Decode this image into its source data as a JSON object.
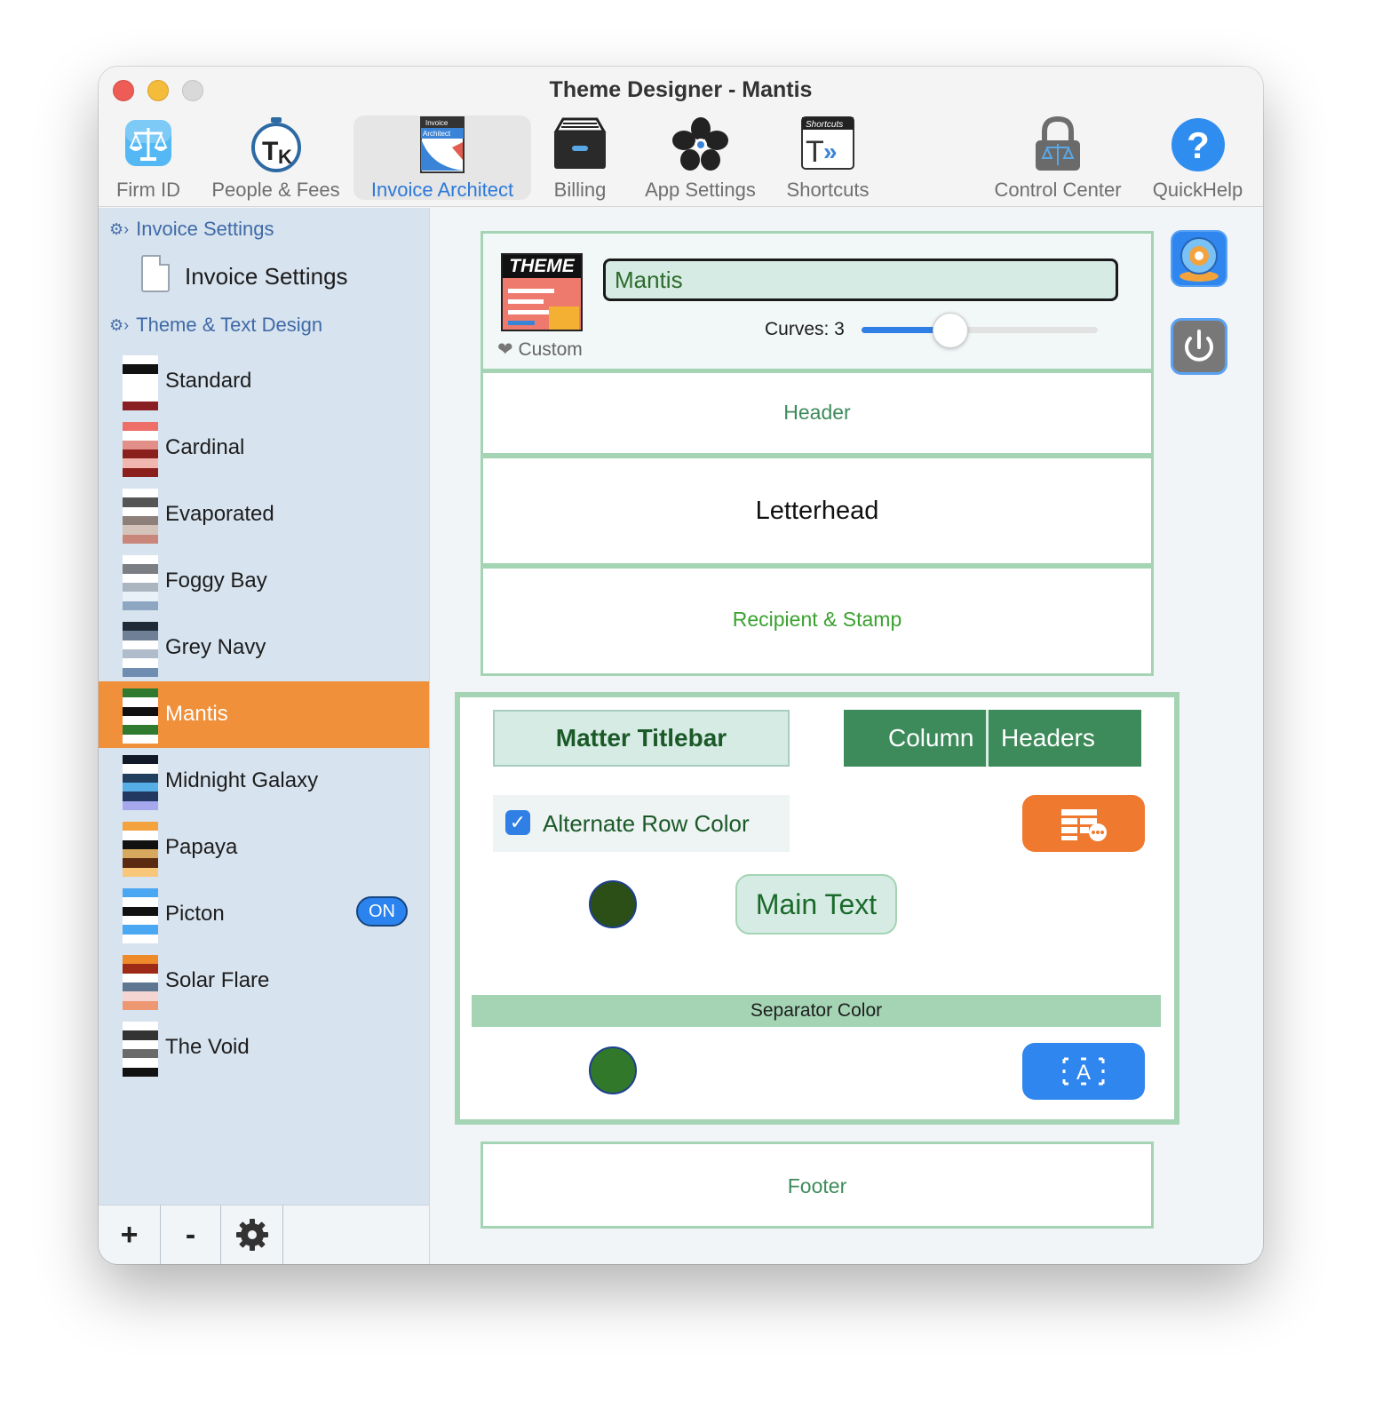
{
  "window": {
    "title": "Theme Designer - Mantis"
  },
  "toolbar": {
    "items": [
      {
        "label": "Firm ID",
        "icon": "scales-icon"
      },
      {
        "label": "People & Fees",
        "icon": "timekeeper-icon"
      },
      {
        "label": "Invoice Architect",
        "icon": "invoice-architect-icon",
        "active": true
      },
      {
        "label": "Billing",
        "icon": "file-box-icon"
      },
      {
        "label": "App Settings",
        "icon": "flower-icon"
      },
      {
        "label": "Shortcuts",
        "icon": "shortcuts-icon"
      },
      {
        "label": "Control Center",
        "icon": "lock-scales-icon"
      },
      {
        "label": "QuickHelp",
        "icon": "question-icon"
      }
    ],
    "invoice_icon_text_1": "Invoice",
    "invoice_icon_text_2": "Architect",
    "shortcuts_icon_text": "Shortcuts"
  },
  "sidebar": {
    "section_invoice": "Invoice Settings",
    "invoice_item": "Invoice Settings",
    "section_theme": "Theme & Text Design",
    "themes": [
      {
        "name": "Standard",
        "stripes": [
          "#ffffff",
          "#111111",
          "#ffffff",
          "#ffffff",
          "#ffffff",
          "#8a1f23"
        ]
      },
      {
        "name": "Cardinal",
        "stripes": [
          "#ee6f6a",
          "#ffffff",
          "#e28f8a",
          "#8a1f1b",
          "#f2b6b0",
          "#8a1f1b"
        ]
      },
      {
        "name": "Evaporated",
        "stripes": [
          "#ffffff",
          "#555555",
          "#ffffff",
          "#8d7f79",
          "#d4c3ba",
          "#c9877c"
        ]
      },
      {
        "name": "Foggy Bay",
        "stripes": [
          "#ffffff",
          "#7b7f84",
          "#ffffff",
          "#aab5c0",
          "#e8f0f8",
          "#8da7c2"
        ]
      },
      {
        "name": "Grey Navy",
        "stripes": [
          "#1f2937",
          "#6f7f95",
          "#ffffff",
          "#b0bccb",
          "#ffffff",
          "#6e8db0"
        ]
      },
      {
        "name": "Mantis",
        "stripes": [
          "#2f7a2f",
          "#ffffff",
          "#111111",
          "#ffffff",
          "#2f7a2f",
          "#ffffff"
        ],
        "selected": true
      },
      {
        "name": "Midnight Galaxy",
        "stripes": [
          "#111827",
          "#ffffff",
          "#233f5f",
          "#55aee6",
          "#223860",
          "#a6a8ee"
        ]
      },
      {
        "name": "Papaya",
        "stripes": [
          "#f3a23e",
          "#ffffff",
          "#111111",
          "#d7a95f",
          "#5a2a12",
          "#f8c77a"
        ]
      },
      {
        "name": "Picton",
        "stripes": [
          "#4aa7f2",
          "#ffffff",
          "#111111",
          "#ffffff",
          "#4aa7f2",
          "#ffffff"
        ],
        "badge": "ON"
      },
      {
        "name": "Solar Flare",
        "stripes": [
          "#ef8a2b",
          "#9d2a17",
          "#ffffff",
          "#5f7692",
          "#f4d5d2",
          "#ee9873"
        ]
      },
      {
        "name": "The Void",
        "stripes": [
          "#ffffff",
          "#333333",
          "#ffffff",
          "#6a6a6a",
          "#ffffff",
          "#111111"
        ]
      }
    ],
    "bottom": {
      "add": "+",
      "remove": "-",
      "settings_icon": "gear-icon"
    }
  },
  "theme_panel": {
    "icon_text": "THEME",
    "name_value": "Mantis",
    "curves_label": "Curves: 3",
    "curves_value": 3,
    "curves_max": 10,
    "custom_label": "Custom"
  },
  "sections": {
    "header": "Header",
    "letterhead": "Letterhead",
    "recipient": "Recipient & Stamp",
    "footer": "Footer"
  },
  "matter": {
    "titlebar": "Matter Titlebar",
    "column": "Column",
    "headers": "Headers",
    "alt_row": "Alternate Row Color",
    "alt_row_checked": true,
    "main_text": "Main Text",
    "separator": "Separator Color",
    "circle1_color": "#2b4f17",
    "circle2_color": "#32782a",
    "orange_btn_icon": "table-options-icon",
    "blue_btn_icon": "text-select-icon"
  },
  "colors": {
    "accent_green": "#3d8b5b",
    "panel_border": "#a4d4b4",
    "selection": "#f0903a",
    "blue": "#2f86ee",
    "orange": "#ef7a2f"
  }
}
